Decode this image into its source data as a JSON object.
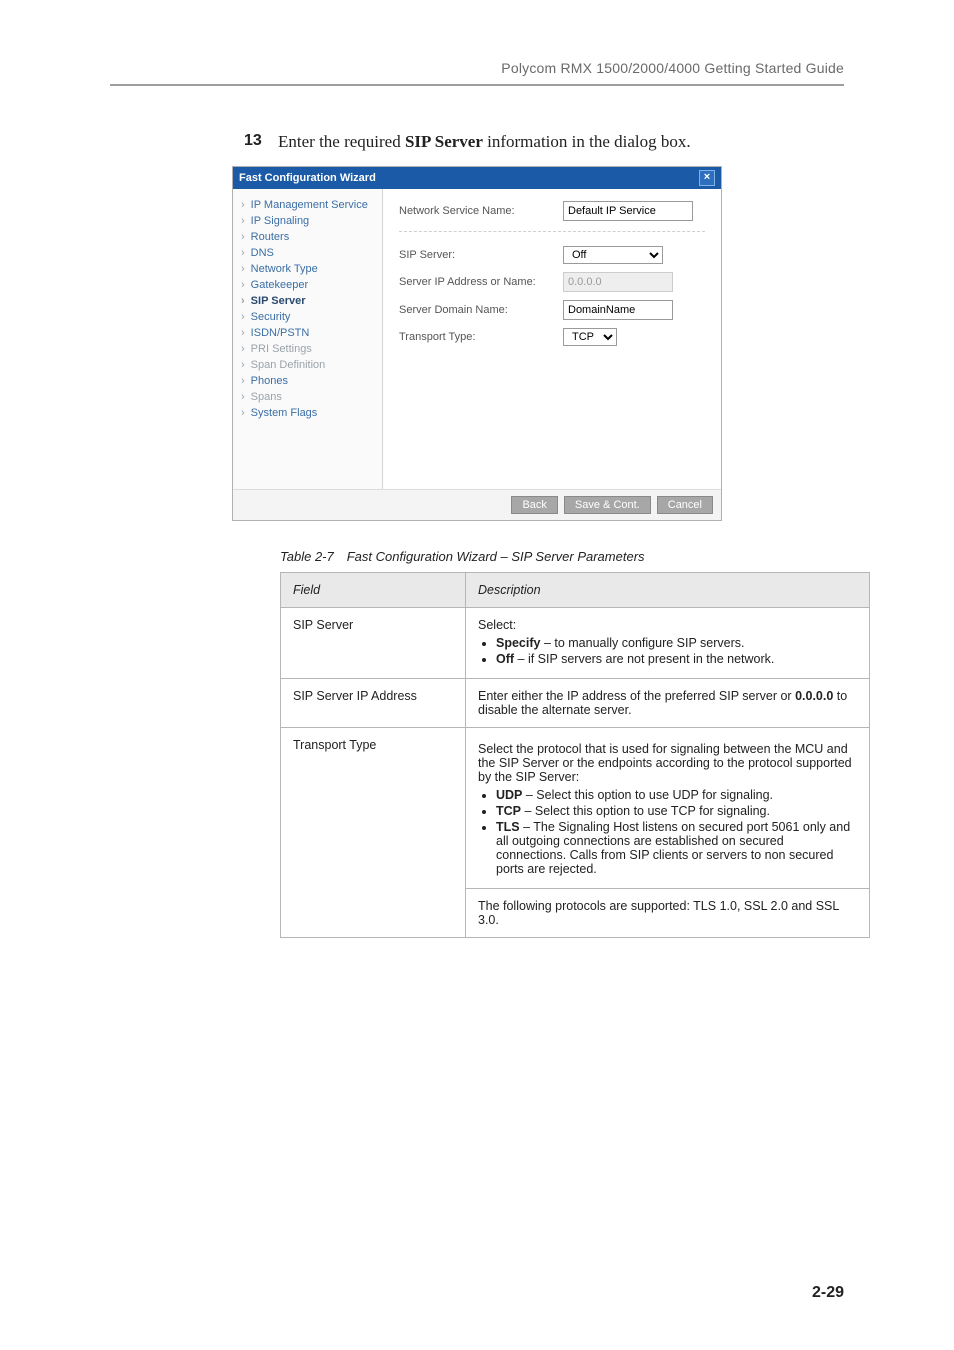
{
  "runhead": "Polycom RMX 1500/2000/4000 Getting Started Guide",
  "step": {
    "number": "13",
    "text_prefix": "Enter the required ",
    "text_bold": "SIP Server",
    "text_suffix": " information in the dialog box."
  },
  "wizard": {
    "title": "Fast Configuration Wizard",
    "side_items": [
      {
        "label": "IP Management Service",
        "state": "done"
      },
      {
        "label": "IP Signaling",
        "state": "done"
      },
      {
        "label": "Routers",
        "state": "done"
      },
      {
        "label": "DNS",
        "state": "done"
      },
      {
        "label": "Network Type",
        "state": "done"
      },
      {
        "label": "Gatekeeper",
        "state": "done"
      },
      {
        "label": "SIP Server",
        "state": "current"
      },
      {
        "label": "Security",
        "state": "done"
      },
      {
        "label": "ISDN/PSTN",
        "state": "done"
      },
      {
        "label": "PRI Settings",
        "state": "dim"
      },
      {
        "label": "Span Definition",
        "state": "dim"
      },
      {
        "label": "Phones",
        "state": "done"
      },
      {
        "label": "Spans",
        "state": "dim"
      },
      {
        "label": "System Flags",
        "state": "done"
      }
    ],
    "labels": {
      "network_service_name": "Network Service Name:",
      "sip_server": "SIP Server:",
      "server_ip_or_name": "Server IP Address or Name:",
      "server_domain_name": "Server Domain Name:",
      "transport_type": "Transport Type:"
    },
    "values": {
      "network_service_name": "Default IP Service",
      "sip_server": "Off",
      "server_ip_or_name": "0.0.0.0",
      "server_domain_name": "DomainName",
      "transport_type": "TCP"
    },
    "buttons": {
      "back": "Back",
      "save_cont": "Save & Cont.",
      "cancel": "Cancel"
    }
  },
  "table": {
    "caption": "Table 2-7 Fast Configuration Wizard – SIP Server Parameters",
    "header": {
      "field": "Field",
      "description": "Description"
    },
    "rows": [
      {
        "field": "SIP Server",
        "desc": "Select:",
        "bullets": [
          {
            "b": "Specify",
            "rest": " – to manually configure SIP servers."
          },
          {
            "b": "Off",
            "rest": " – if SIP servers are not present in the network."
          }
        ]
      },
      {
        "field": "SIP Server IP Address",
        "desc_prefix": "Enter either the IP address of the preferred SIP server or ",
        "desc_bold": "0.0.0.0",
        "desc_suffix": " to disable the alternate server."
      },
      {
        "field": "Transport Type",
        "desc_line1": "Select the protocol that is used for signaling between the MCU and the SIP Server or the endpoints according to the protocol supported by the SIP Server:",
        "bullets2": [
          {
            "b": "UDP",
            "rest": " – Select this option to use UDP for signaling."
          },
          {
            "b": "TCP",
            "rest": " – Select this option to use TCP for signaling."
          },
          {
            "b": "TLS",
            "rest": " – The Signaling Host listens on secured port 5061 only and all outgoing connections are established on secured connections. Calls from SIP clients or servers to non secured ports are rejected."
          }
        ],
        "tail": "The following protocols are supported: TLS 1.0, SSL 2.0 and SSL 3.0."
      }
    ]
  },
  "page_number": "2-29"
}
